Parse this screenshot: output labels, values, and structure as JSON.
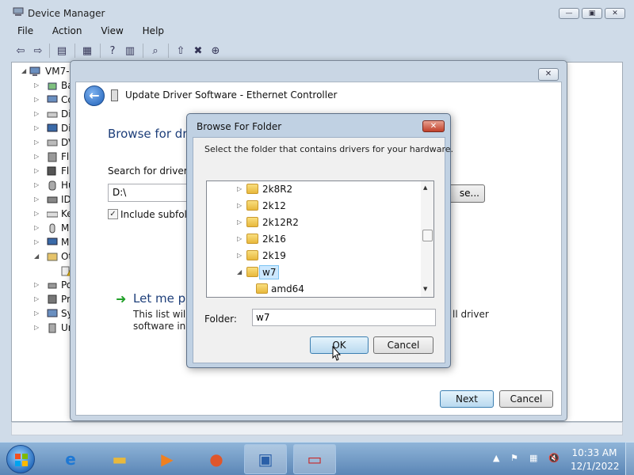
{
  "device_manager": {
    "title": "Device Manager",
    "menu": [
      "File",
      "Action",
      "View",
      "Help"
    ],
    "tree": {
      "root_label": "VM7-",
      "items": [
        "Ba",
        "Co",
        "Di",
        "Di",
        "DV",
        "Fl",
        "Fl",
        "Hu",
        "ID",
        "Ke",
        "M",
        "M",
        "Ot",
        "",
        "Po",
        "Pr",
        "Sy",
        "Un"
      ]
    }
  },
  "wizard": {
    "title": "Update Driver Software - Ethernet Controller",
    "heading": "Browse for driv",
    "search_label": "Search for driver so",
    "path_value": "D:\\",
    "browse_partial": "se...",
    "include_subfolders": "Include subfolde",
    "let_me_pick": "Let me pic",
    "desc_line1_start": "This list will s",
    "desc_line1_end": "ll driver",
    "desc_line2": "software in th",
    "next_label": "Next",
    "cancel_label": "Cancel"
  },
  "browse_folder": {
    "title": "Browse For Folder",
    "instruction": "Select the folder that contains drivers for your hardware.",
    "folders": [
      "2k8R2",
      "2k12",
      "2k12R2",
      "2k16",
      "2k19",
      "w7",
      "amd64"
    ],
    "folder_label": "Folder:",
    "folder_value": "w7",
    "ok_label": "OK",
    "cancel_label": "Cancel"
  },
  "taskbar": {
    "time": "10:33 AM",
    "date": "12/1/2022"
  },
  "colors": {
    "heading_blue": "#1e3f7a",
    "selection": "#cce8ff",
    "taskbar": "#5b86b6"
  }
}
